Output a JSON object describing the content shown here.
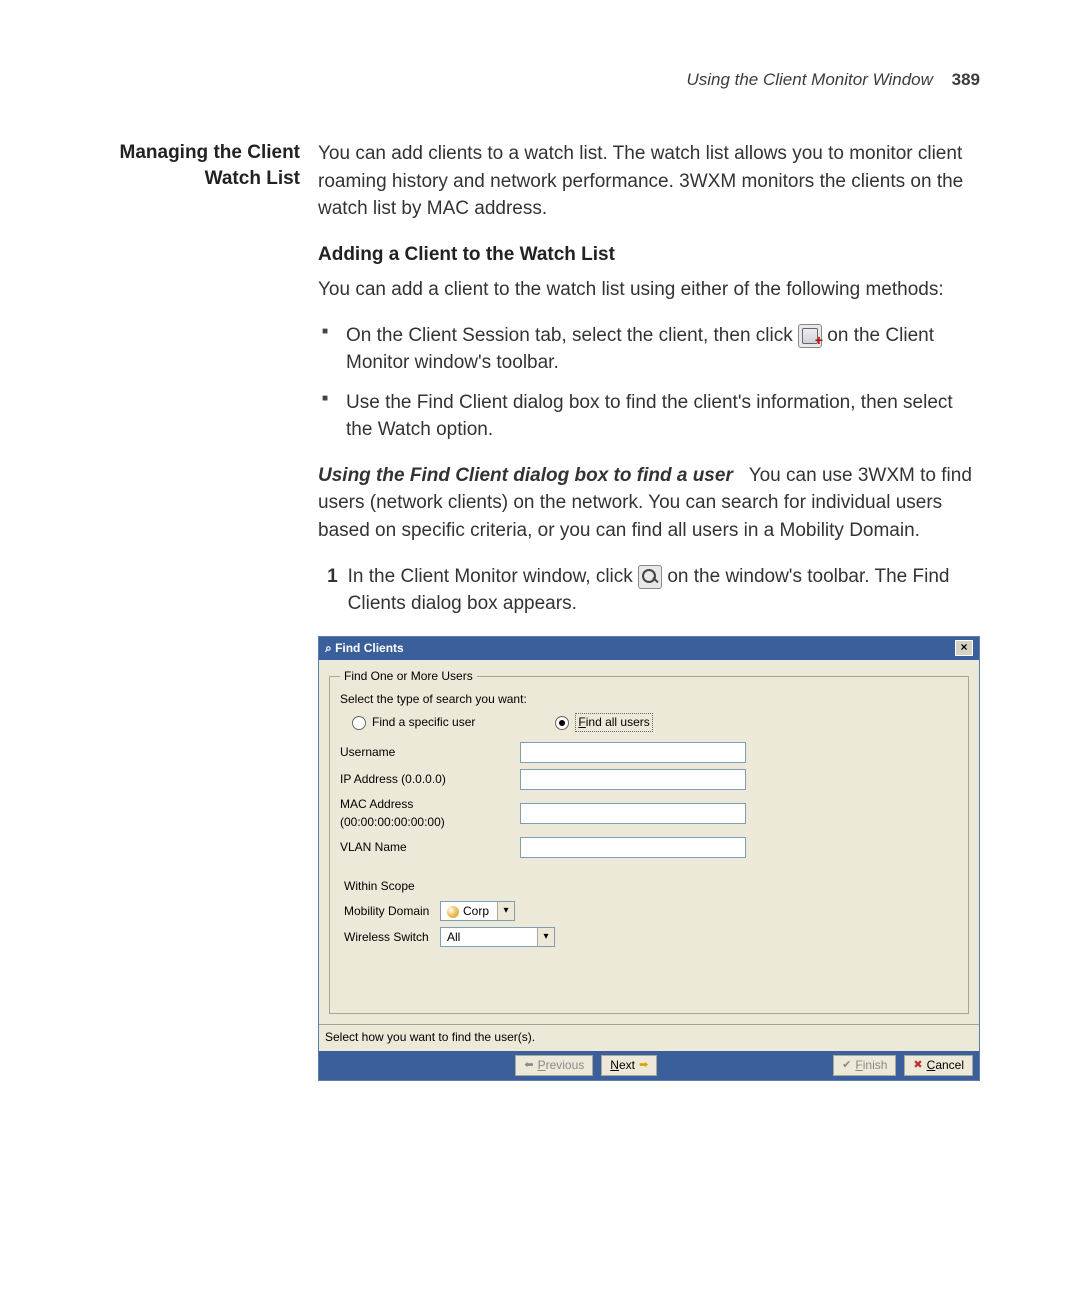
{
  "runningHead": {
    "title": "Using the Client Monitor Window",
    "page": "389"
  },
  "sideHeading": "Managing the Client\nWatch List",
  "intro": "You can add clients to a watch list. The watch list allows you to monitor client roaming history and network performance. 3WXM monitors the clients on the watch list by MAC address.",
  "h3_add": "Adding a Client to the Watch List",
  "add_intro": "You can add a client to the watch list using either of the following methods:",
  "bullets": {
    "b1a": "On the Client Session tab, select the client, then click ",
    "b1b": " on the Client Monitor window's toolbar.",
    "b2": "Use the Find Client dialog box to find the client's information, then select the Watch option."
  },
  "run_in": "Using the Find Client dialog box to find a user",
  "run_body": "You can use 3WXM to find users (network clients) on the network. You can search for individual users based on specific criteria, or you can find all users in a Mobility Domain.",
  "step1": {
    "num": "1",
    "a": "In the Client Monitor window, click ",
    "b": " on the window's toolbar. The Find Clients dialog box appears."
  },
  "dialog": {
    "title": "Find Clients",
    "legend": "Find One or More Users",
    "prompt": "Select the type of search you want:",
    "radio_specific": "Find a specific user",
    "radio_all_prefix": "F",
    "radio_all_rest": "ind all users",
    "fields": {
      "username": "Username",
      "ip": "IP Address (0.0.0.0)",
      "mac": "MAC Address (00:00:00:00:00:00)",
      "vlan": "VLAN Name"
    },
    "scope": {
      "heading": "Within Scope",
      "mobility_label": "Mobility Domain",
      "mobility_value": "Corp",
      "switch_label": "Wireless Switch",
      "switch_value": "All"
    },
    "hint": "Select how you want to find the user(s).",
    "buttons": {
      "previous_p": "P",
      "previous_rest": "revious",
      "next_n": "N",
      "next_rest": "ext",
      "finish_f": "F",
      "finish_rest": "inish",
      "cancel_c": "C",
      "cancel_rest": "ancel"
    }
  }
}
